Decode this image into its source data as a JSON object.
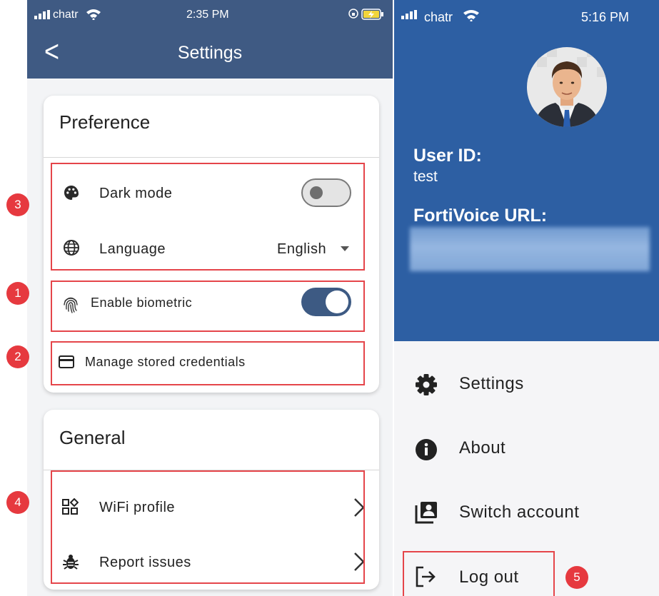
{
  "left": {
    "status": {
      "carrier": "chatr",
      "time": "2:35 PM"
    },
    "appbar": {
      "title": "Settings"
    },
    "preference": {
      "title": "Preference",
      "dark_mode": {
        "label": "Dark mode",
        "enabled": false
      },
      "language": {
        "label": "Language",
        "value": "English"
      },
      "biometric": {
        "label": "Enable biometric",
        "enabled": true
      },
      "credentials": {
        "label": "Manage stored credentials"
      }
    },
    "general": {
      "title": "General",
      "wifi": {
        "label": "WiFi profile"
      },
      "report": {
        "label": "Report issues"
      }
    }
  },
  "right": {
    "status": {
      "carrier": "chatr",
      "time": "5:16 PM"
    },
    "user_id_label": "User ID:",
    "user_id_value": "test",
    "url_label": "FortiVoice URL:",
    "menu": {
      "settings": "Settings",
      "about": "About",
      "switch_account": "Switch account",
      "logout": "Log out"
    }
  },
  "annotations": {
    "badge_1": "1",
    "badge_2": "2",
    "badge_3": "3",
    "badge_4": "4",
    "badge_5": "5"
  },
  "colors": {
    "left_header": "#3f5a83",
    "right_header": "#2d5fa3",
    "highlight_red": "#e5454a",
    "toggle_on": "#3d5a83"
  }
}
